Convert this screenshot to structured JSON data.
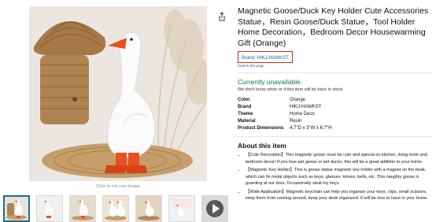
{
  "product": {
    "title": "Magnetic Goose/Duck Key Holder Cute Accessories Statue，Resin Goose/Duck Statue，Tool Holder Home Decoration，Bedroom Decor Housewarming Gift (Orange)",
    "brand_label": "Brand: HIKJ-HAWKST",
    "search_label": "Search this page"
  },
  "availability": {
    "status": "Currently unavailable.",
    "note": "We don't know when or if this item will be back in stock."
  },
  "specs": [
    {
      "key": "Color",
      "value": "Orange"
    },
    {
      "key": "Brand",
      "value": "HIKJ-HAWKST"
    },
    {
      "key": "Theme",
      "value": "Home Deco"
    },
    {
      "key": "Material",
      "value": "Resin"
    },
    {
      "key": "Product Dimensions",
      "value": "4.7\"D x 3\"W x 6.7\"H"
    }
  ],
  "about": {
    "heading": "About this item",
    "bullets": [
      "【Cute Decoration】This magnetic goose must be cute and special on kitchen, living room and bedroom decor! If you love pet geese or pet ducks, this will be a great addition to your home.",
      "【Magnetic Key Holder】This is goose statue magnetic key holder with a magnet on the beak, which can fix metal objects such as keys, glasses, knives, bells, etc. This naughty goose is guarding at our door. Occasionally steal my keys.",
      "【Wide Application】Magnetic keychain can help you organize your keys, clips, small scissors, keep them from running around, keep your desk organized. It will be nice to have in your home."
    ]
  },
  "gallery": {
    "zoom_hint": "Click to roll over image",
    "thumb_count": 7
  },
  "colors": {
    "accent_link": "#2162a1",
    "available_green": "#0b7b3e",
    "highlight_box": "#d12a2a",
    "goose_beak": "#e8501e"
  }
}
